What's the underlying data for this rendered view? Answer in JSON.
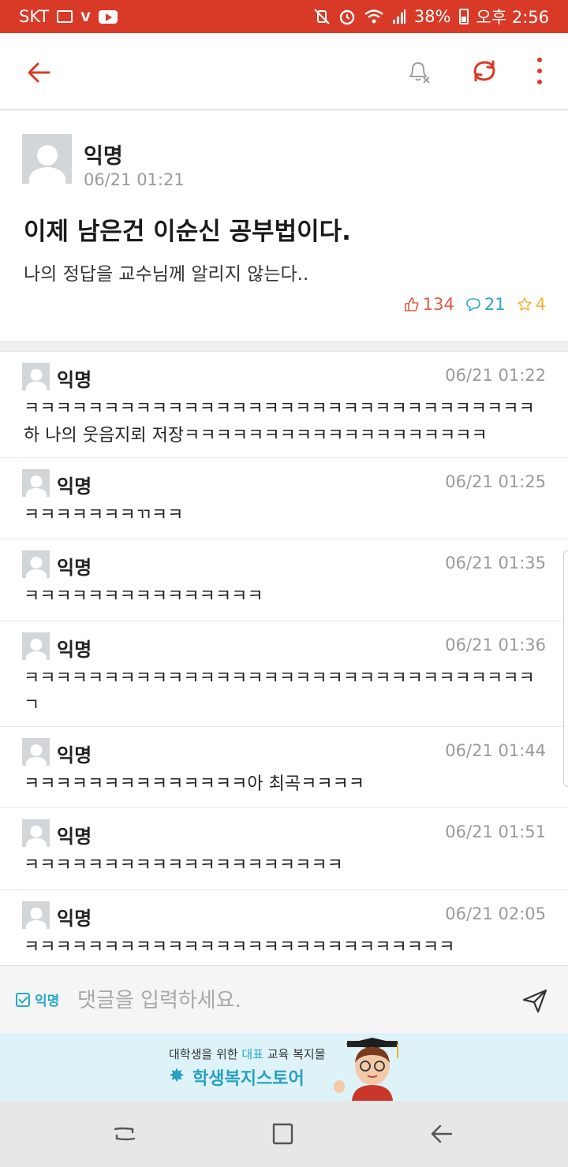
{
  "status_bar": {
    "carrier": "SKT",
    "battery": "38%",
    "time": "오후 2:56",
    "color": "#d93a27"
  },
  "app_bar": {
    "icons": [
      "back-arrow-icon",
      "notification-off-icon",
      "refresh-icon",
      "more-vert-icon"
    ],
    "accent": "#d93a27"
  },
  "post": {
    "author": "익명",
    "date": "06/21 01:21",
    "title": "이제 남은건 이순신 공부법이다.",
    "body": "나의 정답을 교수님께 알리지 않는다..",
    "likes": "134",
    "comments": "21",
    "scraps": "4",
    "like_color": "#e05a42",
    "comment_color": "#2aa8c4",
    "scrap_color": "#f0b43a"
  },
  "comments": [
    {
      "author": "익명",
      "date": "06/21 01:22",
      "text": "ㅋㅋㅋㅋㅋㅋㅋㅋㅋㅋㅋㅋㅋㅋㅋㅋㅋㅋㅋㅋㅋㅋㅋㅋㅋㅋㅋㅋㅋㅋㅋㅋ하 나의 웃음지뢰 저장ㅋㅋㅋㅋㅋㅋㅋㅋㅋㅋㅋㅋㅋㅋㅋㅋㅋㅋㅋ"
    },
    {
      "author": "익명",
      "date": "06/21 01:25",
      "text": "ㅋㅋㅋㅋㅋㅋㅋㄲㅋㅋ"
    },
    {
      "author": "익명",
      "date": "06/21 01:35",
      "text": "ㅋㅋㅋㅋㅋㅋㅋㅋㅋㅋㅋㅋㅋㅋㅋ"
    },
    {
      "author": "익명",
      "date": "06/21 01:36",
      "text": "ㅋㅋㅋㅋㅋㅋㅋㅋㅋㅋㅋㅋㅋㅋㅋㅋㅋㅋㅋㅋㅋㅋㅋㅋㅋㅋㅋㅋㅋㅋㅋㅋㄱ"
    },
    {
      "author": "익명",
      "date": "06/21 01:44",
      "text": "ㅋㅋㅋㅋㅋㅋㅋㅋㅋㅋㅋㅋㅋㅋ아 최곡ㅋㅋㅋㅋ"
    },
    {
      "author": "익명",
      "date": "06/21 01:51",
      "text": "ㅋㅋㅋㅋㅋㅋㅋㅋㅋㅋㅋㅋㅋㅋㅋㅋㅋㅋㅋㅋ"
    },
    {
      "author": "익명",
      "date": "06/21 02:05",
      "text": "ㅋㅋㅋㅋㅋㅋㅋㅋㅋㅋㅋㅋㅋㅋㅋㅋㅋㅋㅋㅋㅋㅋㅋㅋㅋㅋㅋ"
    }
  ],
  "input_bar": {
    "anon_label": "익명",
    "placeholder": "댓글을 입력하세요.",
    "send_icon": "send-icon"
  },
  "banner": {
    "line1_prefix": "대학생을 위한 ",
    "line1_highlight": "대표",
    "line1_suffix": " 교육 복지몰",
    "line2": "학생복지스토어"
  },
  "nav_bar": {
    "icons": [
      "recents-icon",
      "home-icon",
      "back-icon"
    ]
  }
}
